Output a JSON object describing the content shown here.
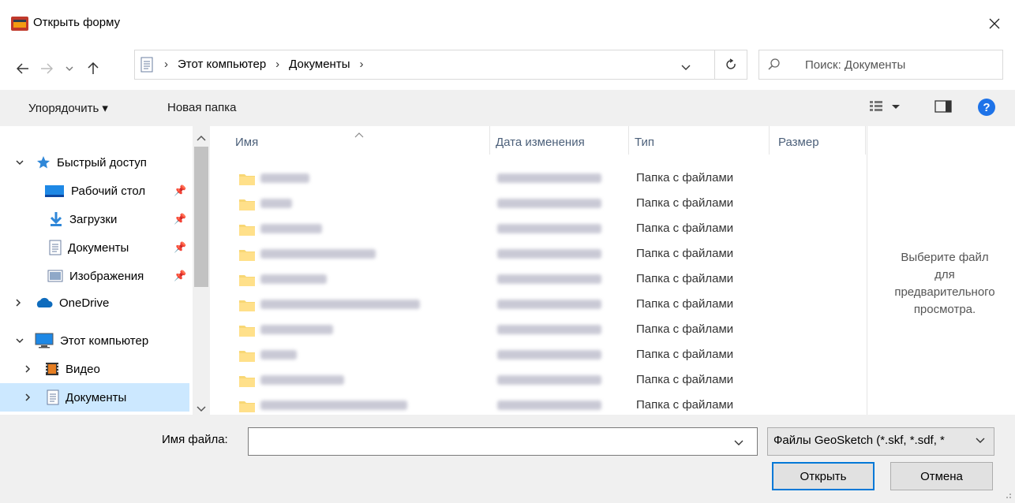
{
  "window": {
    "title": "Открыть форму"
  },
  "address": {
    "crumbs": [
      "Этот компьютер",
      "Документы"
    ]
  },
  "search": {
    "placeholder": "Поиск: Документы"
  },
  "toolbar": {
    "organize_label": "Упорядочить ▾",
    "new_folder_label": "Новая папка"
  },
  "nav": {
    "items": [
      {
        "label": "Быстрый доступ"
      },
      {
        "label": "Рабочий стол"
      },
      {
        "label": "Загрузки"
      },
      {
        "label": "Документы"
      },
      {
        "label": "Изображения"
      },
      {
        "label": "OneDrive"
      },
      {
        "label": "Этот компьютер"
      },
      {
        "label": "Видео"
      },
      {
        "label": "Документы"
      }
    ]
  },
  "columns": {
    "name": "Имя",
    "date": "Дата изменения",
    "type": "Тип",
    "size": "Размер"
  },
  "files": [
    {
      "type": "Папка с файлами"
    },
    {
      "type": "Папка с файлами"
    },
    {
      "type": "Папка с файлами"
    },
    {
      "type": "Папка с файлами"
    },
    {
      "type": "Папка с файлами"
    },
    {
      "type": "Папка с файлами"
    },
    {
      "type": "Папка с файлами"
    },
    {
      "type": "Папка с файлами"
    },
    {
      "type": "Папка с файлами"
    },
    {
      "type": "Папка с файлами"
    }
  ],
  "preview": {
    "line1": "Выберите файл",
    "line2": "для",
    "line3": "предварительного",
    "line4": "просмотра."
  },
  "bottom": {
    "filename_label": "Имя файла:",
    "filename_value": "",
    "filter_value": "Файлы GeoSketch (*.skf, *.sdf, *",
    "open_label": "Открыть",
    "cancel_label": "Отмена"
  },
  "colors": {
    "accent": "#0078d7",
    "selection": "#cce8ff",
    "folder": "#f8d775",
    "help": "#1e73e8"
  }
}
